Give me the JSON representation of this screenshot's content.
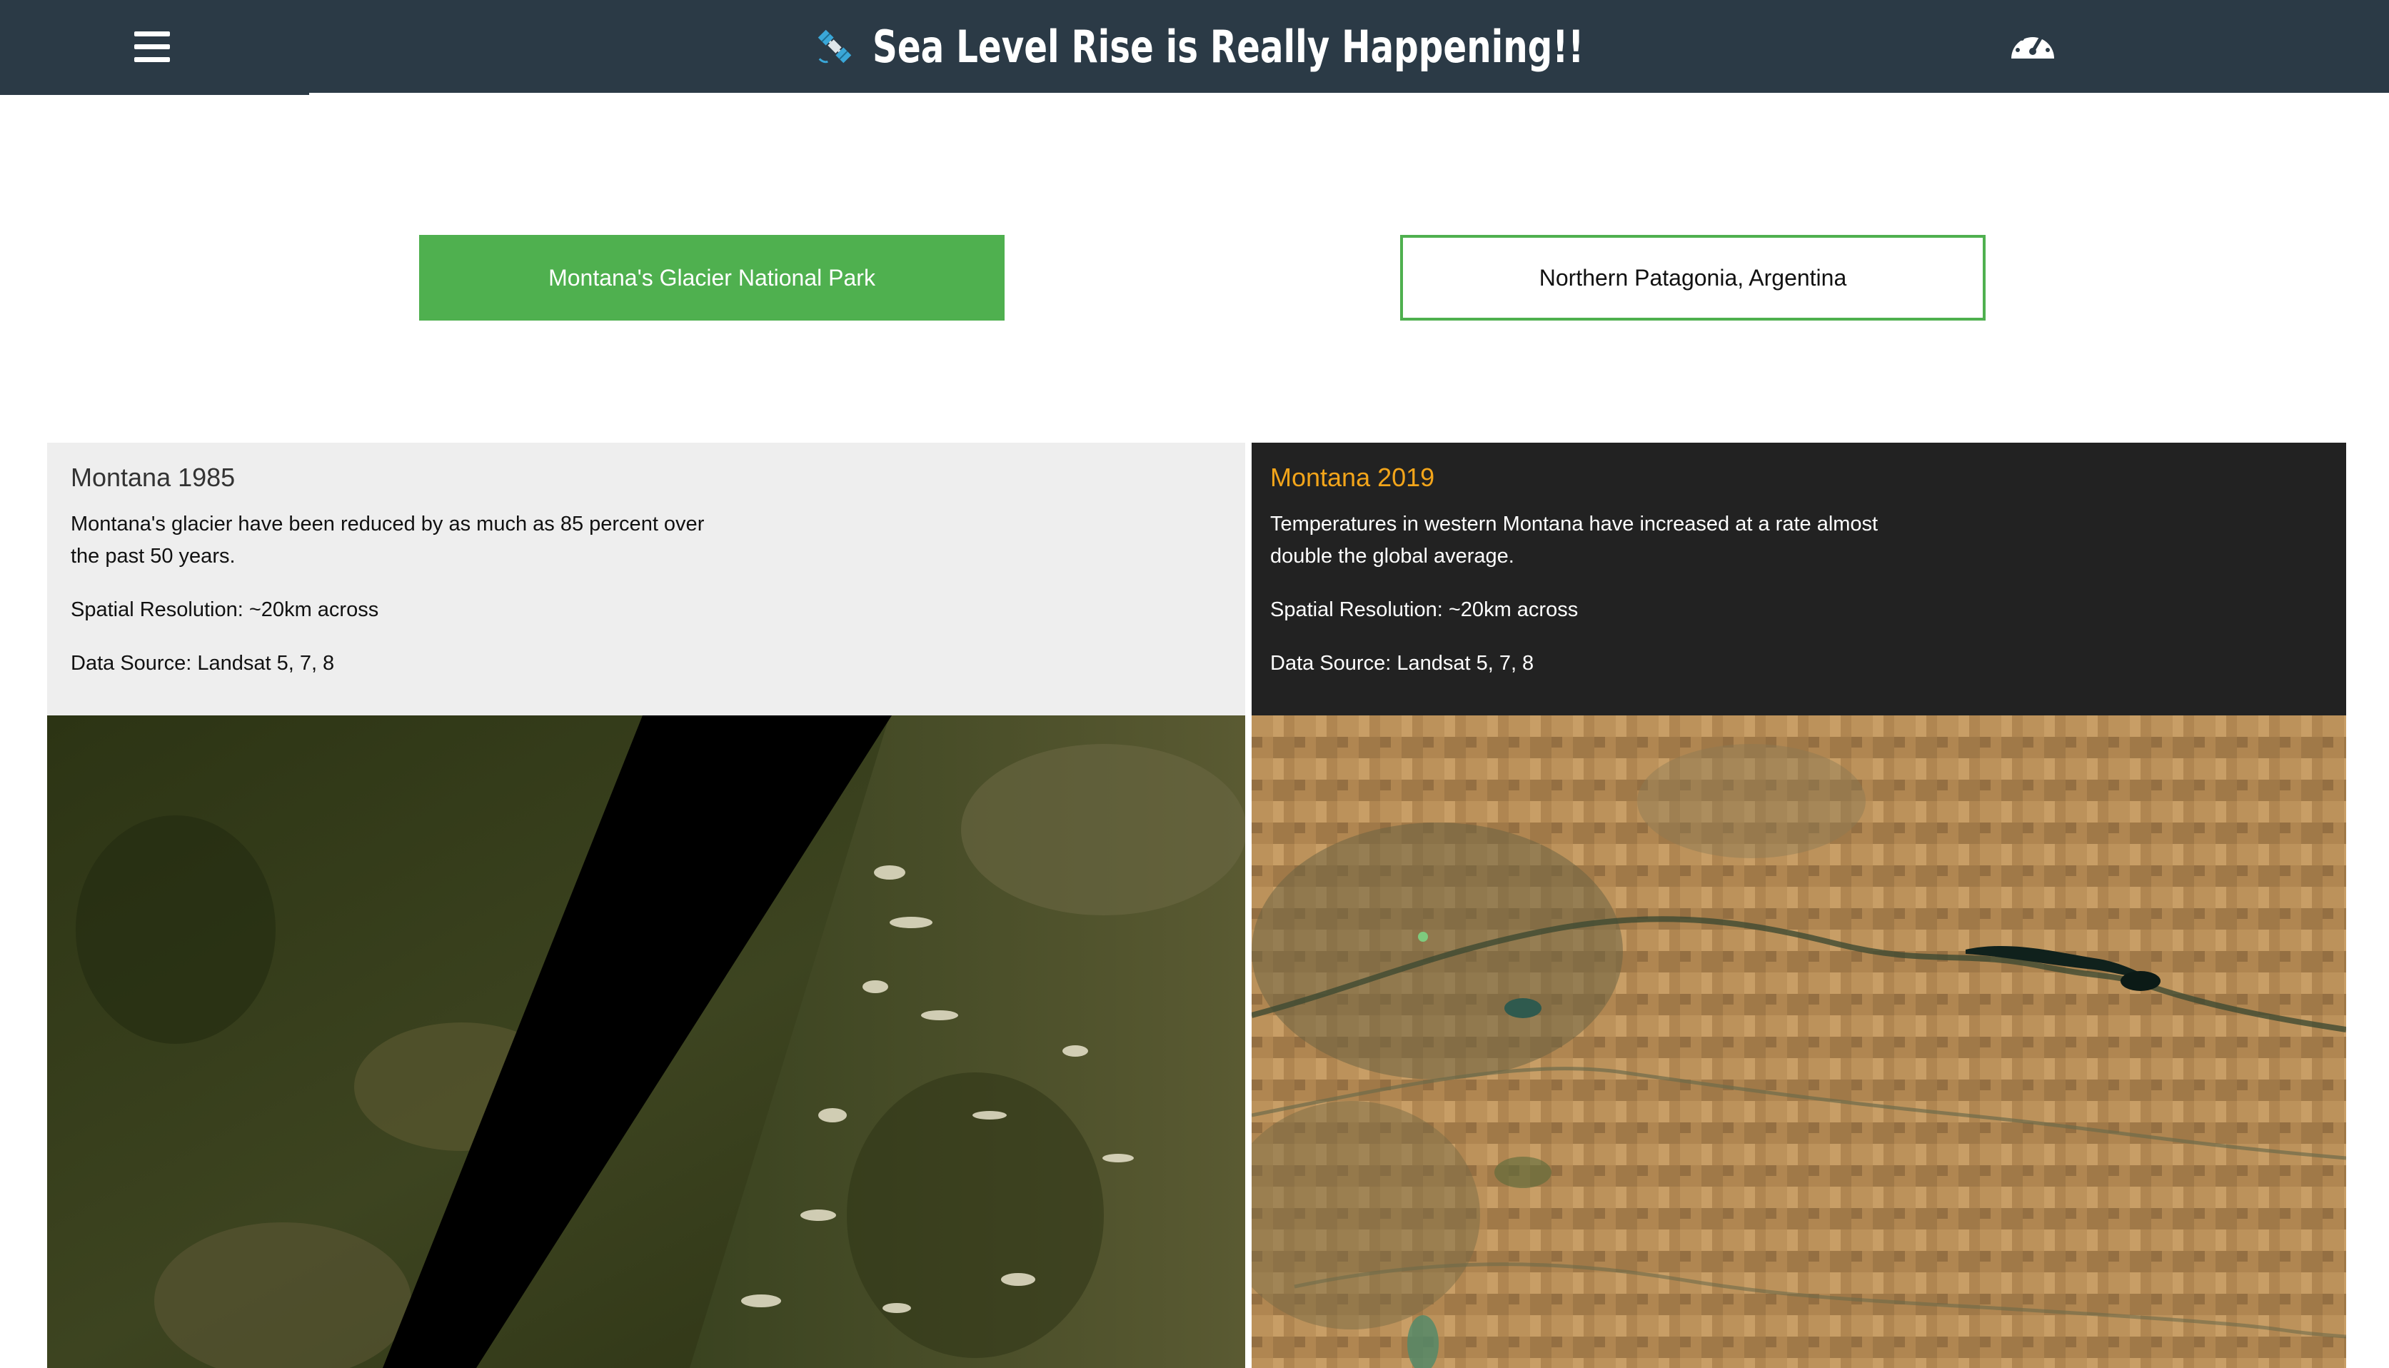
{
  "header": {
    "title": "Sea Level Rise is Really Happening!!",
    "menu_icon": "hamburger-menu-icon",
    "brand_icon": "satellite-icon",
    "right_icon": "dashboard-gauge-icon",
    "background_color": "#2b3a46"
  },
  "tabs": [
    {
      "label": "Montana's Glacier National Park",
      "active": true
    },
    {
      "label": "Northern Patagonia, Argentina",
      "active": false
    }
  ],
  "accent_color": "#4fb04f",
  "panels": {
    "left": {
      "title": "Montana 1985",
      "description": "Montana's glacier have been reduced by as much as 85 percent over the past 50 years.",
      "resolution": "Spatial Resolution: ~20km across",
      "source": "Data Source: Landsat 5, 7, 8"
    },
    "right": {
      "title": "Montana 2019",
      "description": "Temperatures in western Montana have increased at a rate almost double the global average.",
      "resolution": "Spatial Resolution: ~20km across",
      "source": "Data Source: Landsat 5, 7, 8",
      "title_color": "#f3a51a"
    }
  }
}
